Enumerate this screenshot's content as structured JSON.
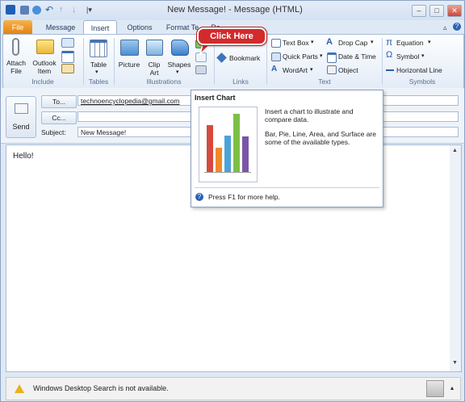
{
  "window": {
    "title": "New Message! - Message (HTML)",
    "controls": [
      "–",
      "□",
      "✕"
    ]
  },
  "tabs": [
    "File",
    "Message",
    "Insert",
    "Options",
    "Format Te",
    "Re"
  ],
  "ribbon": {
    "groups": {
      "include": "Include",
      "tables": "Tables",
      "illustrations": "Illustrations",
      "links": "Links",
      "text": "Text",
      "symbols": "Symbols"
    },
    "include": {
      "attach_file": [
        "Attach",
        "File"
      ],
      "outlook_item": [
        "Outlook",
        "Item"
      ]
    },
    "table": "Table",
    "illustrations": {
      "picture": "Picture",
      "clip_art": [
        "Clip",
        "Art"
      ],
      "shapes": "Shapes"
    },
    "links": {
      "bookmark": "Bookmark"
    },
    "text": {
      "text_box": "Text Box",
      "quick_parts": "Quick Parts",
      "wordart": "WordArt",
      "drop_cap": "Drop Cap",
      "date_time": "Date & Time",
      "object": "Object"
    },
    "symbols": {
      "equation": "Equation",
      "symbol": "Symbol",
      "horizontal_line": "Horizontal Line"
    }
  },
  "callout": "Click Here",
  "envelope": {
    "send": "Send",
    "to_button": "To...",
    "cc_button": "Cc...",
    "subject_label": "Subject:",
    "to_value": "technoencyclopedia@gmail.com",
    "cc_value": "",
    "subject_value": "New Message!"
  },
  "body_text": "Hello!",
  "tooltip": {
    "title": "Insert Chart",
    "desc1": "Insert a chart to illustrate and compare data.",
    "desc2": "Bar, Pie, Line, Area, and Surface are some of the available types.",
    "help": "Press F1 for more help."
  },
  "status": {
    "message": "Windows Desktop Search is not available."
  },
  "colors": {
    "file_tab": "#e27f12",
    "callout": "#d12b2b",
    "ribbon": "#e3ecf7"
  }
}
